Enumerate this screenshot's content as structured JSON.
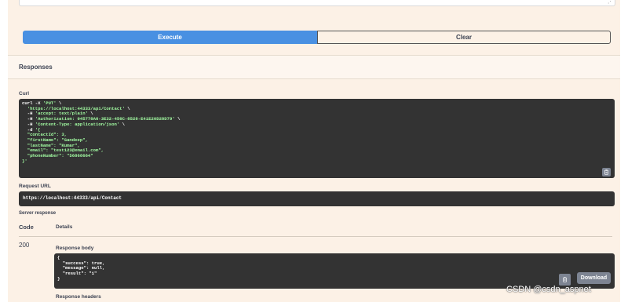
{
  "request": {
    "execute_label": "Execute",
    "clear_label": "Clear"
  },
  "responses": {
    "title": "Responses",
    "curl_label": "Curl",
    "curl_lines": [
      {
        "plain": "curl -X ",
        "str": "'PUT'",
        "tail": " \\"
      },
      {
        "plain": "  ",
        "str": "'https://localhost:44333/api/Contact'",
        "tail": " \\"
      },
      {
        "plain": "  -H ",
        "str": "'accept: text/plain'",
        "tail": " \\"
      },
      {
        "plain": "  -H ",
        "str": "'Authorization: 045778A6-3E32-456C-8528-E41E20D28D79'",
        "tail": " \\"
      },
      {
        "plain": "  -H ",
        "str": "'Content-Type: application/json'",
        "tail": " \\"
      },
      {
        "plain": "  -d ",
        "str": "'{",
        "tail": ""
      },
      {
        "plain": "",
        "str": "  \"contactId\": 3,",
        "tail": ""
      },
      {
        "plain": "",
        "str": "  \"firstName\": \"Sandeep\",",
        "tail": ""
      },
      {
        "plain": "",
        "str": "  \"lastName\": \"Kumar\",",
        "tail": ""
      },
      {
        "plain": "",
        "str": "  \"email\": \"test123@email.com\",",
        "tail": ""
      },
      {
        "plain": "",
        "str": "  \"phoneNumber\": \"56868664\"",
        "tail": ""
      },
      {
        "plain": "",
        "str": "}'",
        "tail": ""
      }
    ],
    "request_url_label": "Request URL",
    "request_url": "https://localhost:44333/api/Contact",
    "server_response_label": "Server response",
    "code_header": "Code",
    "details_header": "Details",
    "status_code": "200",
    "response_body_label": "Response body",
    "response_body_lines": [
      {
        "key": "",
        "val": "{"
      },
      {
        "key": "  \"success\"",
        "val": ": true,"
      },
      {
        "key": "  \"message\"",
        "val": ": null,"
      },
      {
        "key": "  \"result\"",
        "val": ": \"1\""
      },
      {
        "key": "",
        "val": "}"
      }
    ],
    "download_label": "Download",
    "response_headers_label": "Response headers"
  },
  "icons": {
    "copy": "clipboard-icon",
    "resize": "resize-grip-icon"
  },
  "watermark": "CSDN @csdn_aspnet",
  "colors": {
    "background": "#fcf1e6",
    "execute": "#4990e2",
    "code_bg": "#333333",
    "string": "#a2fca2",
    "button_grey": "#7d8492"
  }
}
